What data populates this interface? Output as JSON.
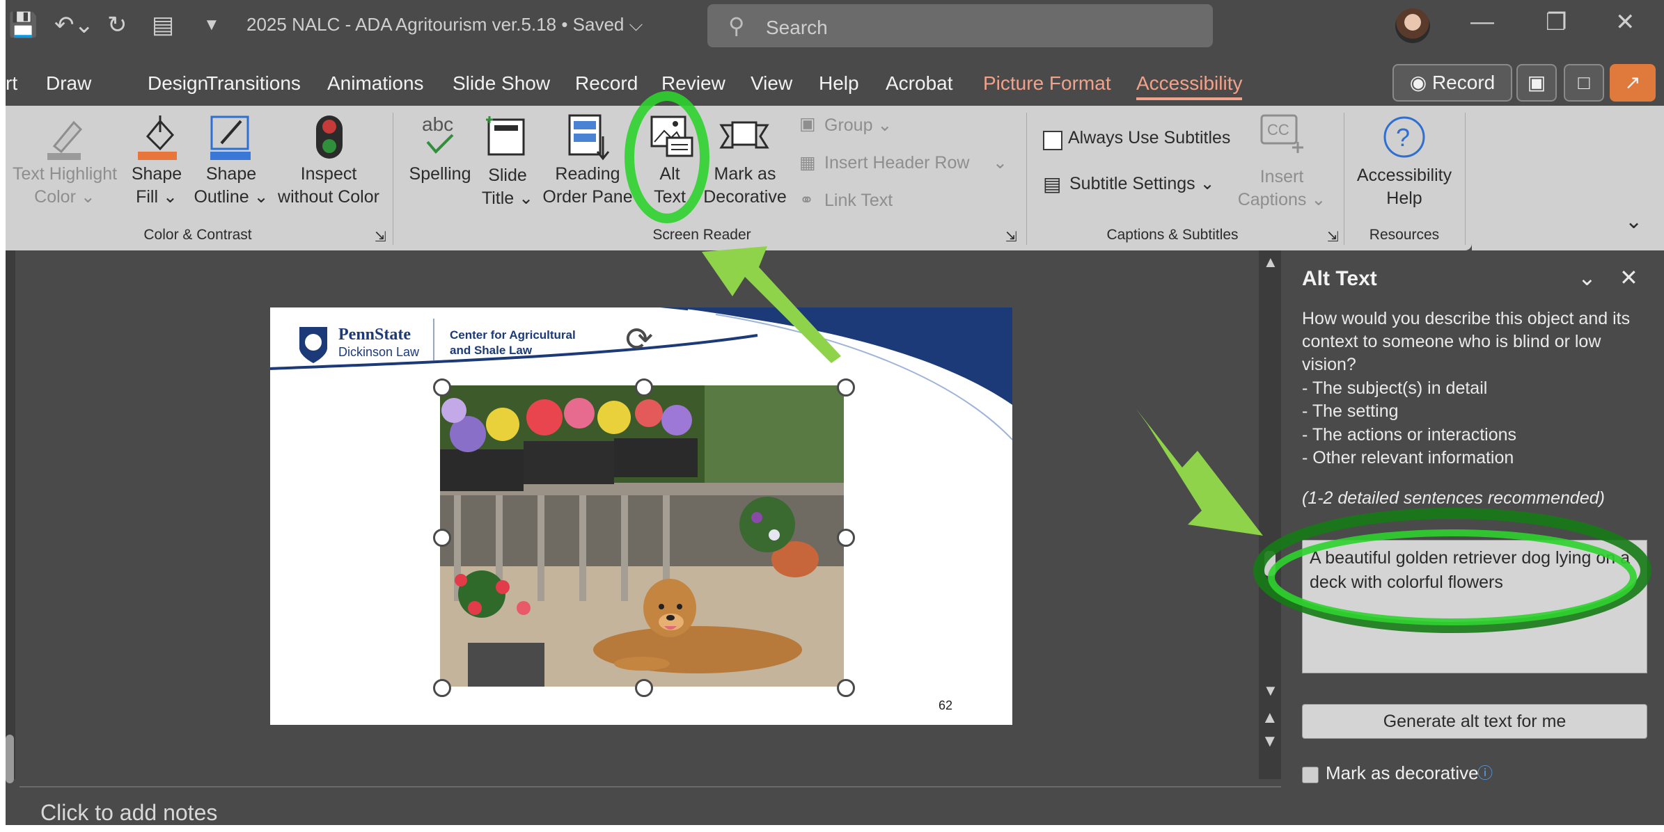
{
  "window": {
    "doc_title": "2025 NALC - ADA Agritourism ver.5.18 • Saved ⌵",
    "search_placeholder": "Search"
  },
  "tabs": [
    "rt",
    "Draw",
    "Design",
    "Transitions",
    "Animations",
    "Slide Show",
    "Record",
    "Review",
    "View",
    "Help",
    "Acrobat",
    "Picture Format",
    "Accessibility"
  ],
  "tab_buttons": {
    "record": "◉ Record"
  },
  "ribbon": {
    "color_contrast": {
      "text_highlight": [
        "Text Highlight",
        "Color ⌄"
      ],
      "shape_fill": [
        "Shape",
        "Fill ⌄"
      ],
      "shape_outline": [
        "Shape",
        "Outline ⌄"
      ],
      "inspect": [
        "Inspect",
        "without Color"
      ],
      "group_label": "Color & Contrast"
    },
    "screen_reader": {
      "spelling": "Spelling",
      "slide_title": [
        "Slide",
        "Title ⌄"
      ],
      "reading_order": [
        "Reading",
        "Order Pane"
      ],
      "alt_text": [
        "Alt",
        "Text"
      ],
      "mark_decorative": [
        "Mark as",
        "Decorative"
      ],
      "group": "Group ⌄",
      "insert_header_row": "Insert Header Row",
      "link_text": "Link Text",
      "group_label": "Screen Reader"
    },
    "captions": {
      "always_subtitles": "Always Use Subtitles",
      "subtitle_settings": "Subtitle Settings ⌄",
      "insert_captions": [
        "Insert",
        "Captions ⌄"
      ],
      "group_label": "Captions & Subtitles"
    },
    "resources": {
      "help": [
        "Accessibility",
        "Help"
      ],
      "group_label": "Resources"
    }
  },
  "slide": {
    "logo_name": "PennState",
    "logo_sub": "Dickinson Law",
    "center_line1": "Center for Agricultural",
    "center_line2": "and Shale Law",
    "page_number": "62"
  },
  "notes_placeholder": "Click to add notes",
  "pane": {
    "title": "Alt Text",
    "prompt": [
      "How would you describe this object and its",
      "context to someone who is blind or low",
      "vision?",
      "- The subject(s) in detail",
      "- The setting",
      "- The actions or interactions",
      "- Other relevant information"
    ],
    "recommend": "(1-2 detailed sentences recommended)",
    "alt_value": "A beautiful golden retriever dog lying on a deck with colorful flowers",
    "generate_button": "Generate alt text for me",
    "decorative_label": "Mark as decorative"
  },
  "colors": {
    "accent": "#f0a28a",
    "highlight_green": "#2fd12f",
    "arrow_green": "#8ed34a",
    "ribbon_bg": "#d0d0d0",
    "app_bg": "#4a4a4a"
  }
}
